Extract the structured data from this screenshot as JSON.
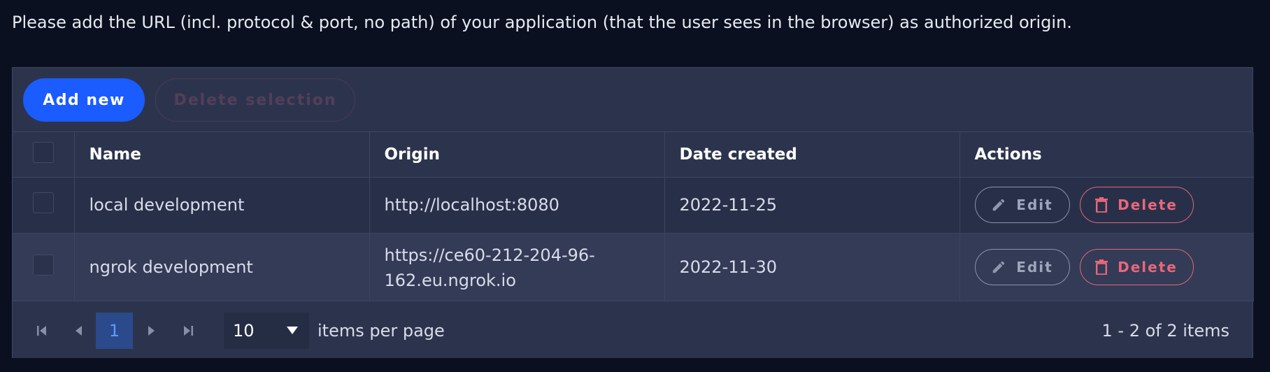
{
  "intro_text": "Please add the URL (incl. protocol & port, no path) of your application (that the user sees in the browser) as authorized origin.",
  "toolbar": {
    "add_label": "Add new",
    "delete_selection_label": "Delete selection"
  },
  "table": {
    "columns": [
      "Name",
      "Origin",
      "Date created",
      "Actions"
    ],
    "rows": [
      {
        "name": "local development",
        "origin": "http://localhost:8080",
        "date": "2022-11-25"
      },
      {
        "name": "ngrok development",
        "origin_line1": "https://ce60-212-204-96-",
        "origin_line2": "162.eu.ngrok.io",
        "date": "2022-11-30"
      }
    ],
    "edit_label": "Edit",
    "delete_label": "Delete"
  },
  "pagination": {
    "current_page": "1",
    "page_size": "10",
    "items_per_page_label": "items per page",
    "summary": "1 - 2 of 2 items"
  },
  "icons": {
    "first": "first-page-icon",
    "prev": "prev-page-icon",
    "next": "next-page-icon",
    "last": "last-page-icon",
    "edit": "pencil-icon",
    "delete": "trash-icon",
    "dropdown": "caret-down-icon"
  },
  "colors": {
    "background": "#0b1020",
    "panel": "#2c344d",
    "accent": "#1a5cff",
    "danger": "#e8687b"
  }
}
